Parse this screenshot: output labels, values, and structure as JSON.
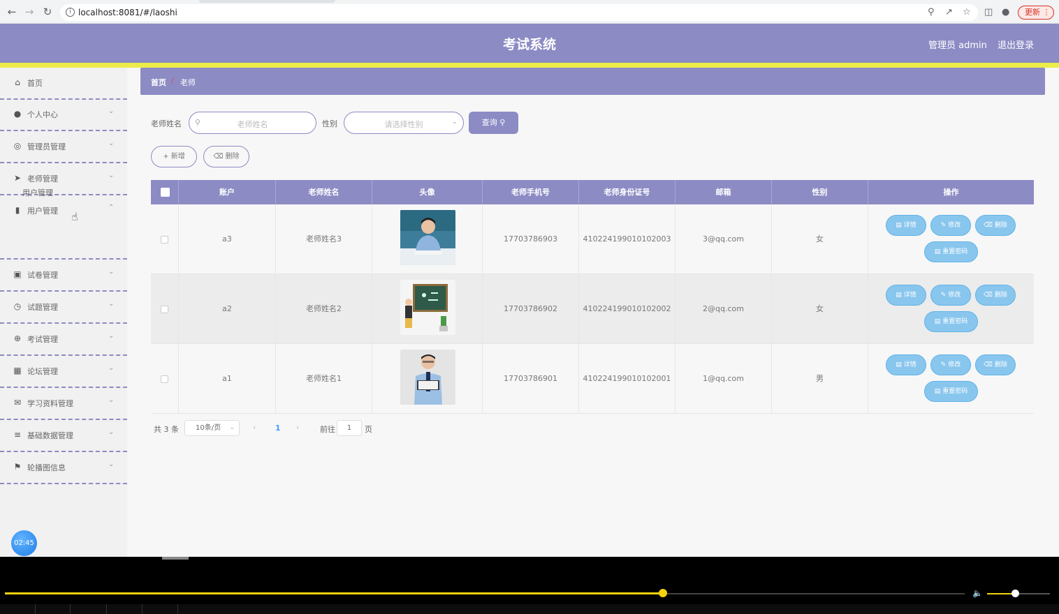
{
  "browser": {
    "url": "localhost:8081/#/laoshi",
    "update_label": "更新"
  },
  "header": {
    "title": "考试系统",
    "user_label": "管理员 admin",
    "logout_label": "退出登录"
  },
  "sidebar": {
    "items": [
      {
        "label": "首页",
        "icon": "home-icon"
      },
      {
        "label": "个人中心",
        "icon": "user-icon"
      },
      {
        "label": "管理员管理",
        "icon": "compass-icon"
      },
      {
        "label": "老师管理",
        "icon": "send-icon"
      },
      {
        "label": "用户管理",
        "icon": "chart-icon"
      },
      {
        "label": "试卷管理",
        "icon": "document-icon"
      },
      {
        "label": "试题管理",
        "icon": "clock-icon"
      },
      {
        "label": "考试管理",
        "icon": "crosshair-icon"
      },
      {
        "label": "论坛管理",
        "icon": "grid-icon"
      },
      {
        "label": "学习资料管理",
        "icon": "mail-icon"
      },
      {
        "label": "基础数据管理",
        "icon": "sliders-icon"
      },
      {
        "label": "轮播图信息",
        "icon": "flag-icon"
      }
    ],
    "submenu_label": "用户管理",
    "timer": "02:45"
  },
  "breadcrumb": {
    "home": "首页",
    "separator": "/",
    "current": "老师"
  },
  "search": {
    "name_label": "老师姓名",
    "name_placeholder": "老师姓名",
    "gender_label": "性别",
    "gender_placeholder": "请选择性别",
    "query_label": "查询"
  },
  "actions": {
    "add_label": "新增",
    "delete_label": "删除"
  },
  "table": {
    "headers": [
      "账户",
      "老师姓名",
      "头像",
      "老师手机号",
      "老师身份证号",
      "邮箱",
      "性别",
      "操作"
    ],
    "rows": [
      {
        "account": "a3",
        "name": "老师姓名3",
        "phone": "17703786903",
        "id_number": "410224199010102003",
        "email": "3@qq.com",
        "gender": "女"
      },
      {
        "account": "a2",
        "name": "老师姓名2",
        "phone": "17703786902",
        "id_number": "410224199010102002",
        "email": "2@qq.com",
        "gender": "女"
      },
      {
        "account": "a1",
        "name": "老师姓名1",
        "phone": "17703786901",
        "id_number": "410224199010102001",
        "email": "1@qq.com",
        "gender": "男"
      }
    ],
    "row_actions": {
      "detail": "详情",
      "edit": "修改",
      "delete": "删除",
      "reset": "重置密码"
    }
  },
  "pagination": {
    "total": "共 3 条",
    "page_size": "10条/页",
    "current_page": "1",
    "goto_label": "前往",
    "goto_value": "1",
    "page_suffix": "页"
  },
  "colors": {
    "primary": "#8c8bc4",
    "accent_stripe": "#ecec4a",
    "action_button": "#89c6ee"
  }
}
